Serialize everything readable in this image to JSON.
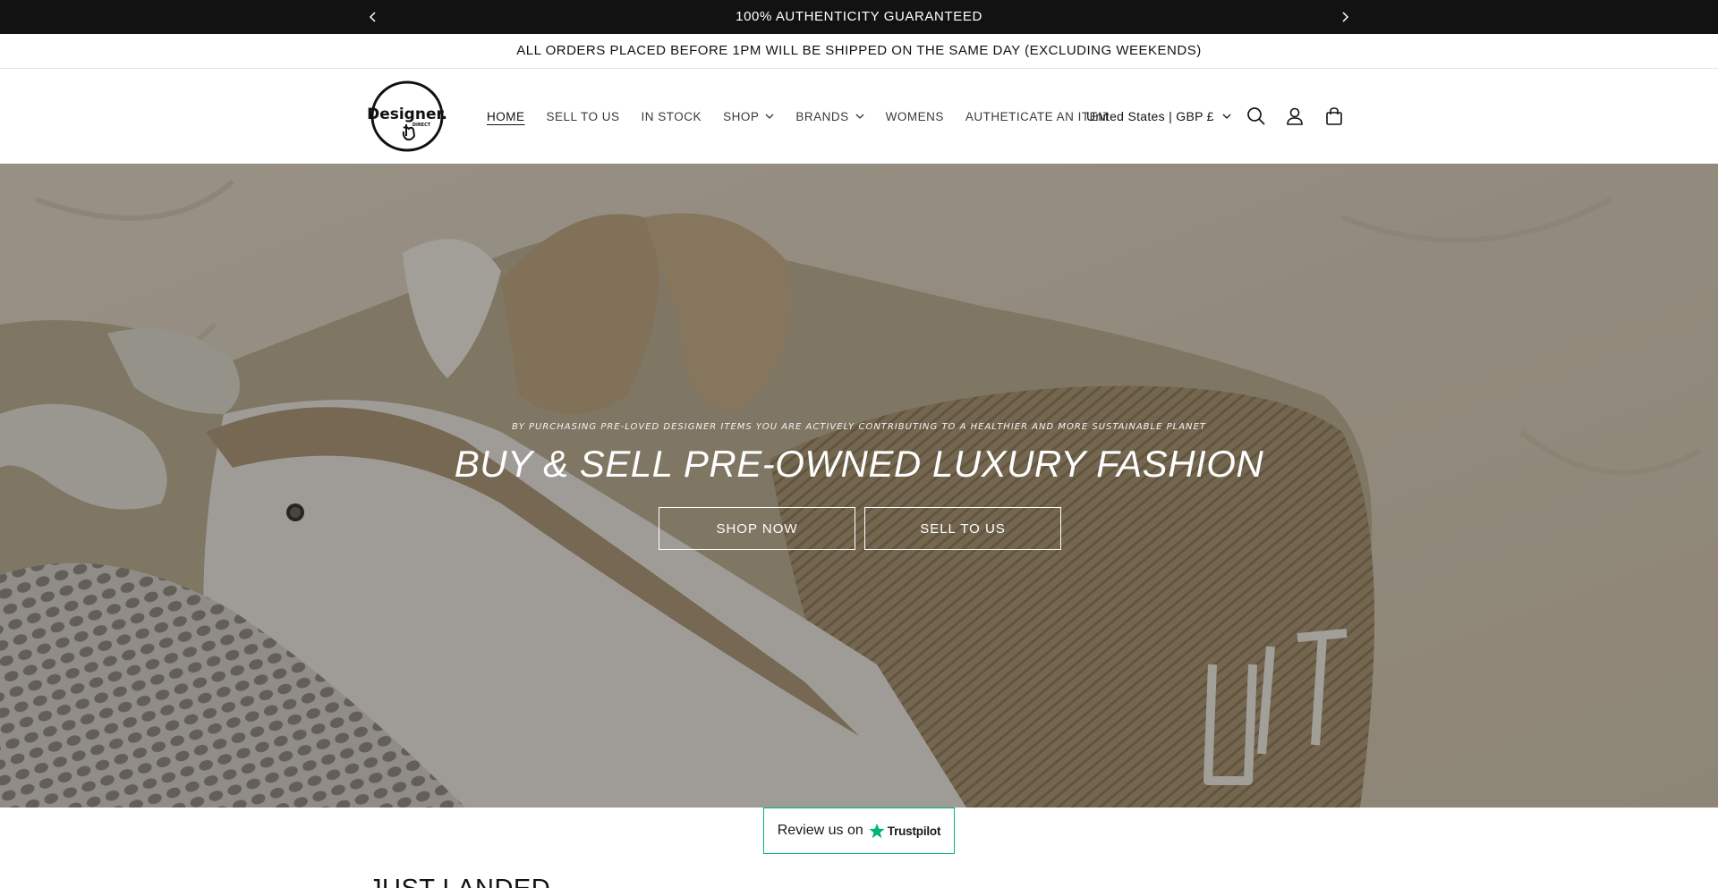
{
  "announcement": {
    "message": "100% AUTHENTICITY GUARANTEED",
    "prev_icon": "chevron-left-icon",
    "next_icon": "chevron-right-icon"
  },
  "shipping_notice": "ALL ORDERS PLACED BEFORE 1PM WILL BE SHIPPED ON THE SAME DAY (EXCLUDING WEEKENDS)",
  "header": {
    "logo_text": "Designer.",
    "logo_subtext": "DIRECT",
    "nav": [
      {
        "label": "HOME",
        "active": true,
        "dropdown": false
      },
      {
        "label": "SELL TO US",
        "active": false,
        "dropdown": false
      },
      {
        "label": "IN STOCK",
        "active": false,
        "dropdown": false
      },
      {
        "label": "SHOP",
        "active": false,
        "dropdown": true
      },
      {
        "label": "BRANDS",
        "active": false,
        "dropdown": true
      },
      {
        "label": "WOMENS",
        "active": false,
        "dropdown": false
      },
      {
        "label": "AUTHETICATE AN ITEM",
        "active": false,
        "dropdown": false
      }
    ],
    "locale": "United States | GBP £",
    "icons": [
      "search-icon",
      "account-icon",
      "cart-icon"
    ]
  },
  "hero": {
    "subtitle": "BY PURCHASING PRE-LOVED DESIGNER ITEMS YOU ARE ACTIVELY CONTRIBUTING TO A HEALTHIER AND MORE SUSTAINABLE PLANET",
    "title": "BUY & SELL PRE-OWNED LUXURY FASHION",
    "shop_button": "SHOP NOW",
    "sell_button": "SELL TO US"
  },
  "trustpilot": {
    "label": "Review us on",
    "brand": "Trustpilot",
    "star_color": "#00b67a"
  },
  "section": {
    "title": "JUST LANDED"
  },
  "colors": {
    "announcement_bg": "#121212",
    "text": "#121212",
    "trustpilot_green": "#00b67a"
  }
}
